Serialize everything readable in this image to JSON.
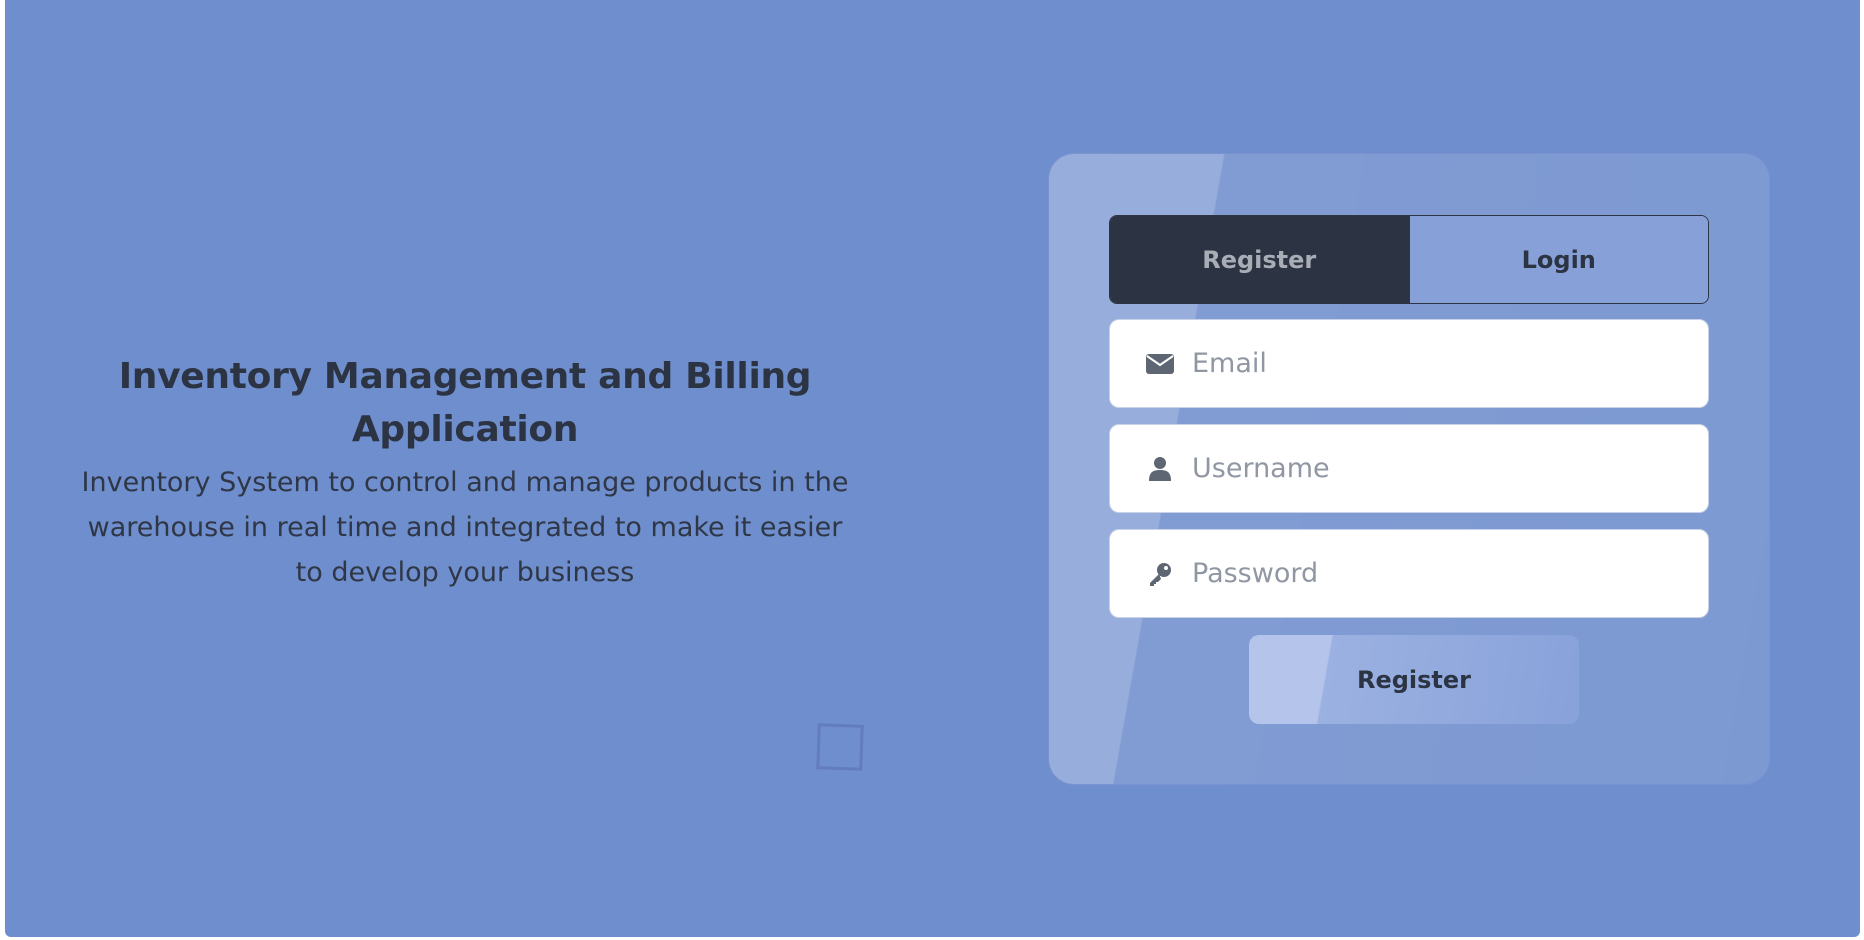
{
  "hero": {
    "title": "Inventory Management and Billing Application",
    "description": "Inventory System to control and manage products in the warehouse in real time and integrated to make it easier to develop your business"
  },
  "auth_card": {
    "tabs": [
      {
        "label": "Register",
        "active": true
      },
      {
        "label": "Login",
        "active": false
      }
    ],
    "fields": {
      "email": {
        "placeholder": "Email",
        "value": "",
        "icon": "envelope-icon"
      },
      "username": {
        "placeholder": "Username",
        "value": "",
        "icon": "user-icon"
      },
      "password": {
        "placeholder": "Password",
        "value": "",
        "icon": "key-icon"
      }
    },
    "submit_label": "Register"
  },
  "colors": {
    "background": "#6f8ecd",
    "dark": "#2c3443",
    "active_tab_text": "#a9adb5"
  }
}
